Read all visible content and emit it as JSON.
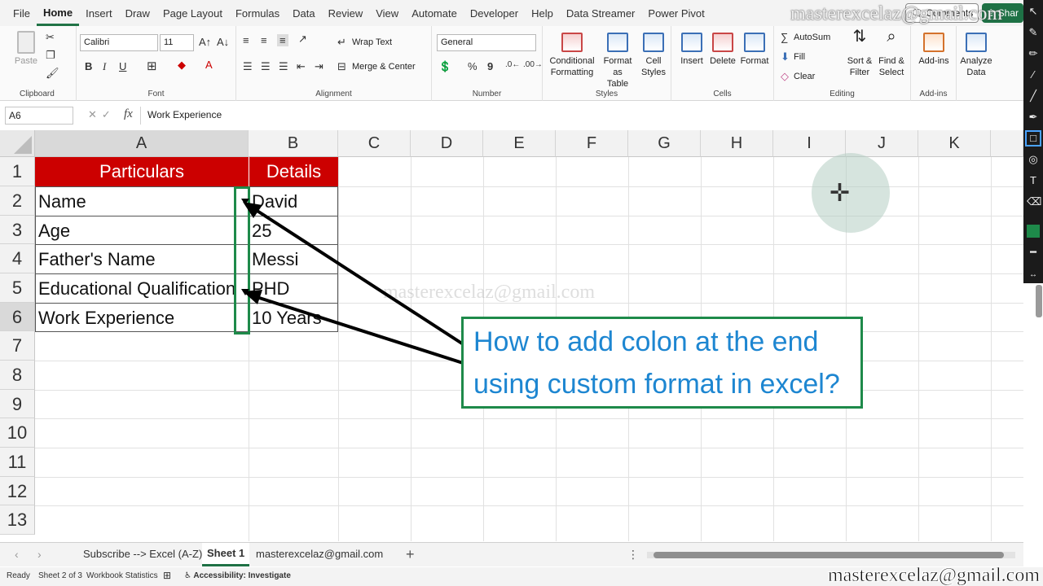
{
  "menu": {
    "tabs": [
      "File",
      "Home",
      "Insert",
      "Draw",
      "Page Layout",
      "Formulas",
      "Data",
      "Review",
      "View",
      "Automate",
      "Developer",
      "Help",
      "Data Streamer",
      "Power Pivot"
    ],
    "comments": "Comments",
    "share": "Shar"
  },
  "ribbon": {
    "clipboard": {
      "paste": "Paste",
      "label": "Clipboard"
    },
    "font": {
      "name": "Calibri",
      "size": "11",
      "label": "Font",
      "bold": "B",
      "italic": "I",
      "underline": "U"
    },
    "alignment": {
      "wrap": "Wrap Text",
      "merge": "Merge & Center",
      "label": "Alignment"
    },
    "number": {
      "format": "General",
      "label": "Number",
      "percent": "%",
      "comma": "9"
    },
    "styles": {
      "conditional_1": "Conditional",
      "conditional_2": "Formatting",
      "format_table_1": "Format as",
      "format_table_2": "Table",
      "cell_styles_1": "Cell",
      "cell_styles_2": "Styles",
      "label": "Styles"
    },
    "cells": {
      "insert": "Insert",
      "delete": "Delete",
      "format": "Format",
      "label": "Cells"
    },
    "editing": {
      "autosum": "AutoSum",
      "fill": "Fill",
      "clear": "Clear",
      "sort_1": "Sort &",
      "sort_2": "Filter",
      "find_1": "Find &",
      "find_2": "Select",
      "label": "Editing"
    },
    "addins": {
      "addins": "Add-ins",
      "label": "Add-ins",
      "analyze_1": "Analyze",
      "analyze_2": "Data"
    }
  },
  "formula_bar": {
    "name_box": "A6",
    "fx": "fx",
    "content": "Work Experience"
  },
  "grid": {
    "columns": [
      "A",
      "B",
      "C",
      "D",
      "E",
      "F",
      "G",
      "H",
      "I",
      "J",
      "K"
    ],
    "rows": [
      "1",
      "2",
      "3",
      "4",
      "5",
      "6",
      "7",
      "8",
      "9",
      "10",
      "11",
      "12",
      "13"
    ],
    "header": {
      "a": "Particulars",
      "b": "Details"
    },
    "data": [
      {
        "a": "Name",
        "b": "David"
      },
      {
        "a": "Age",
        "b": "25"
      },
      {
        "a": "Father's Name",
        "b": "Messi"
      },
      {
        "a": "Educational Qualification",
        "b": "PHD"
      },
      {
        "a": "Work Experience",
        "b": "10 Years"
      }
    ],
    "header_color": "#cc0000"
  },
  "overlay": {
    "callout_line1": "How to add colon at the end",
    "callout_line2": "using custom format in excel?",
    "watermark": "masterexcelaz@gmail.com",
    "callout_border": "#1e8a4a",
    "callout_text_color": "#1d86d1"
  },
  "sheets": {
    "tabs": [
      "Subscribe --> Excel (A-Z)",
      "Sheet 1",
      "masterexcelaz@gmail.com"
    ],
    "active": "Sheet 1",
    "add": "+"
  },
  "status": {
    "ready": "Ready",
    "sheet_of": "Sheet 2 of 3",
    "workbook_stats": "Workbook Statistics",
    "accessibility": "Accessibility: Investigate"
  }
}
